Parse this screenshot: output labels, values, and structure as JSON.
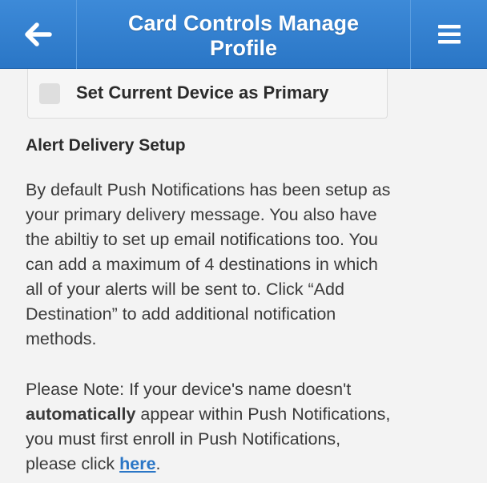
{
  "header": {
    "title_line1": "Card Controls Manage",
    "title_line2": "Profile",
    "back_icon": "arrow-left-icon",
    "menu_icon": "hamburger-menu-icon",
    "color": "#2f7fcf"
  },
  "primary_device": {
    "label": "Set Current Device as Primary",
    "checked": false
  },
  "alert_delivery": {
    "title": "Alert Delivery Setup",
    "paragraph1_lines": [
      "By default Push Notifications has been setup as",
      "your primary delivery message. You also have",
      "the abiltiy to set up email notifications too. You",
      "can add a maximum of 4 destinations in which",
      "all of your alerts will be sent to. Click “Add",
      "Destination” to add additional notification",
      "methods."
    ],
    "note": {
      "line1": "Please Note: If your device's name doesn't",
      "line2_bold": "automatically",
      "line2_rest": " appear within Push Notifications,",
      "line3": "you must first enroll in Push Notifications,",
      "line4_prefix": "please click ",
      "link_text": "here",
      "line4_suffix": "."
    }
  }
}
